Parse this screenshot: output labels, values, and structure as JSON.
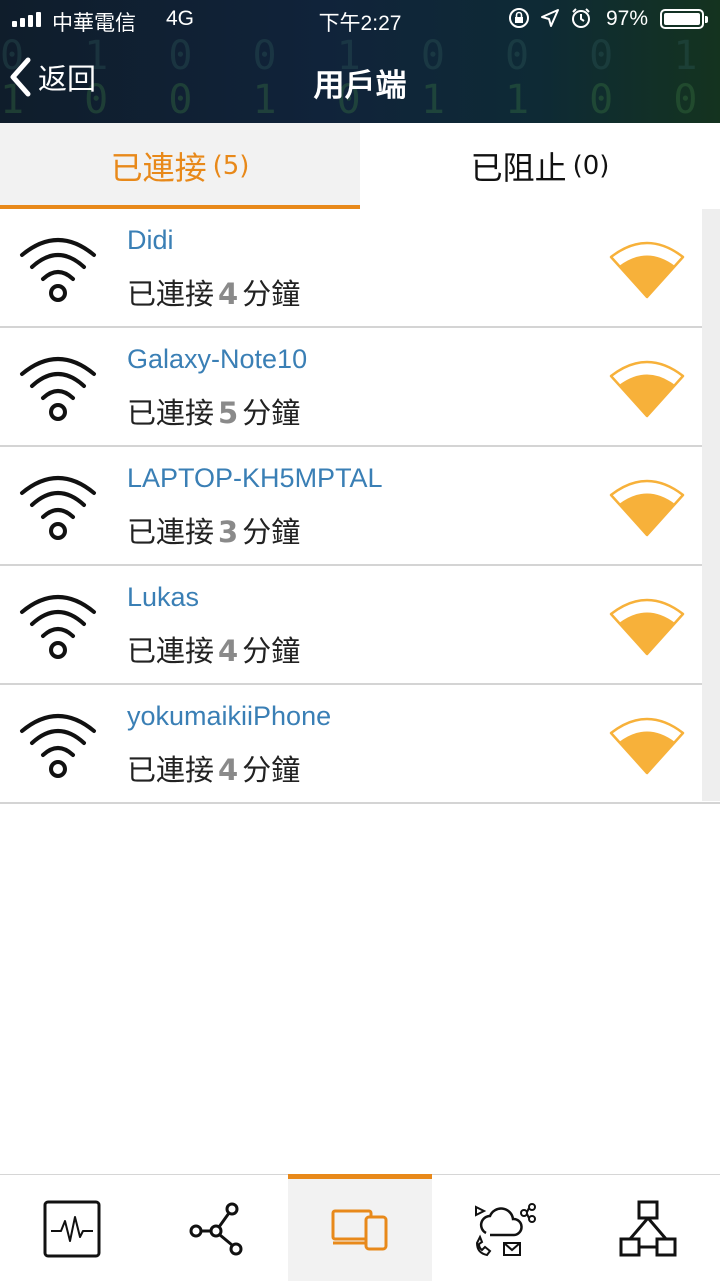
{
  "status_bar": {
    "carrier": "中華電信",
    "network": "4G",
    "time": "下午2:27",
    "battery_percent": "97%"
  },
  "nav": {
    "back_label": "返回",
    "title": "用戶端"
  },
  "tabs": {
    "connected_label": "已連接",
    "connected_count": "(5)",
    "blocked_label": "已阻止",
    "blocked_count": "(0)"
  },
  "clients": [
    {
      "name": "Didi",
      "status_prefix": "已連接",
      "minutes": "4",
      "status_suffix": "分鐘"
    },
    {
      "name": "Galaxy-Note10",
      "status_prefix": "已連接",
      "minutes": "5",
      "status_suffix": "分鐘"
    },
    {
      "name": "LAPTOP-KH5MPTAL",
      "status_prefix": "已連接",
      "minutes": "3",
      "status_suffix": "分鐘"
    },
    {
      "name": "Lukas",
      "status_prefix": "已連接",
      "minutes": "4",
      "status_suffix": "分鐘"
    },
    {
      "name": "yokumaikiiPhone",
      "status_prefix": "已連接",
      "minutes": "4",
      "status_suffix": "分鐘"
    }
  ],
  "bottom_tabs": [
    {
      "icon": "monitor-pulse-icon",
      "active": false
    },
    {
      "icon": "network-nodes-icon",
      "active": false
    },
    {
      "icon": "devices-icon",
      "active": true
    },
    {
      "icon": "cloud-share-icon",
      "active": false
    },
    {
      "icon": "topology-icon",
      "active": false
    }
  ],
  "colors": {
    "accent": "#e8891a",
    "signal": "#f7b13a",
    "client_name": "#3a7fb5"
  }
}
